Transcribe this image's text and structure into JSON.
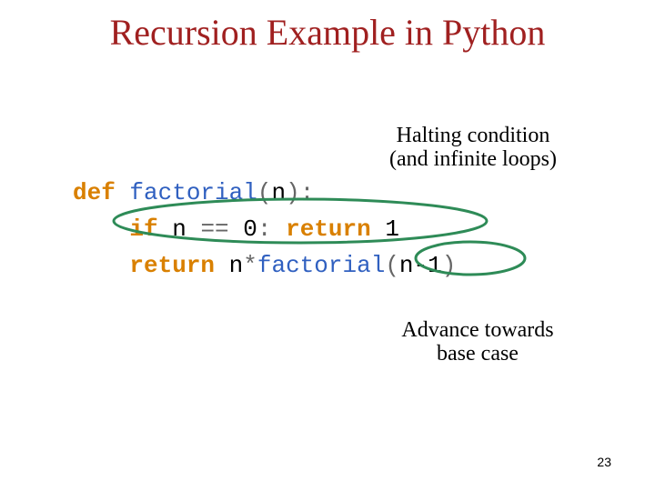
{
  "title": "Recursion Example in Python",
  "annotations": {
    "halting": "Halting condition\n(and infinite loops)",
    "advance": "Advance towards\nbase case"
  },
  "code": {
    "l1_def": "def",
    "l1_fn": "factorial",
    "l1_paren_open": "(",
    "l1_arg": "n",
    "l1_paren_close": ")",
    "l1_colon": ":",
    "l2_if": "if",
    "l2_cond": " n ",
    "l2_eq": "==",
    "l2_zero": " 0",
    "l2_colon": ":",
    "l2_ret": "return",
    "l2_val": " 1",
    "l3_ret": "return",
    "l3_expr_pre": " n",
    "l3_star": "*",
    "l3_fn": "factorial",
    "l3_expr_post_open": "(",
    "l3_nm1": "n-1",
    "l3_expr_post_close": ")"
  },
  "pagenum": "23",
  "ellipse_color": "#2e8b57"
}
